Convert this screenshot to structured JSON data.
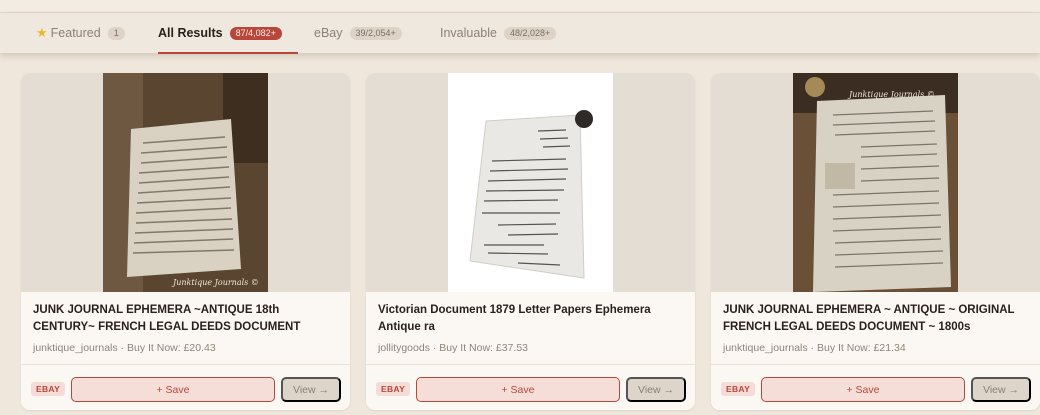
{
  "tabs": [
    {
      "label": "Featured",
      "badge": "1"
    },
    {
      "label": "All Results",
      "badge": "87/4,082+"
    },
    {
      "label": "eBay",
      "badge": "39/2,054+"
    },
    {
      "label": "Invaluable",
      "badge": "48/2,028+"
    }
  ],
  "active_tab": "All Results",
  "colors": {
    "accent": "#b8463a",
    "background": "#efe7dc",
    "card": "#fbf8f3"
  },
  "cards": [
    {
      "title": "JUNK JOURNAL EPHEMERA ~ANTIQUE 18th CENTURY~ FRENCH LEGAL DEEDS DOCUMENT",
      "meta": "junktique_journals · Buy It Now: £20.43",
      "source": "EBAY",
      "save_label": "+ Save",
      "view_label": "View →",
      "image_signature": "Junktique Journals ©"
    },
    {
      "title": "Victorian Document 1879 Letter Papers Ephemera Antique ra",
      "meta": "jollitygoods · Buy It Now: £37.53",
      "source": "EBAY",
      "save_label": "+ Save",
      "view_label": "View →"
    },
    {
      "title": "JUNK JOURNAL EPHEMERA ~ ANTIQUE ~ ORIGINAL FRENCH LEGAL DEEDS DOCUMENT ~ 1800s",
      "meta": "junktique_journals · Buy It Now: £21.34",
      "source": "EBAY",
      "save_label": "+ Save",
      "view_label": "View →",
      "image_signature": "Junktique Journals ©"
    }
  ]
}
